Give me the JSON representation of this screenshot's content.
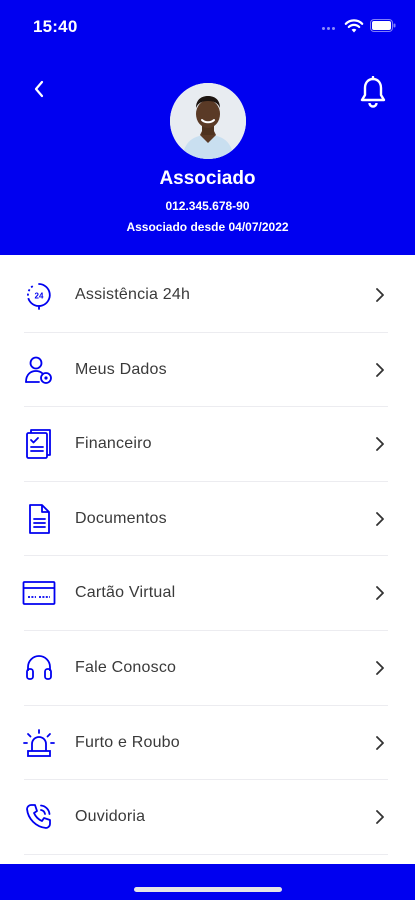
{
  "status_bar": {
    "time": "15:40"
  },
  "header": {
    "name": "Associado",
    "cpf": "012.345.678-90",
    "member_since": "Associado desde 04/07/2022",
    "background_color": "#0000f0"
  },
  "menu": {
    "items": [
      {
        "label": "Assistência 24h",
        "icon": "assistance-24h-icon"
      },
      {
        "label": "Meus Dados",
        "icon": "user-settings-icon"
      },
      {
        "label": "Financeiro",
        "icon": "financial-document-icon"
      },
      {
        "label": "Documentos",
        "icon": "document-icon"
      },
      {
        "label": "Cartão Virtual",
        "icon": "card-icon"
      },
      {
        "label": "Fale Conosco",
        "icon": "headset-icon"
      },
      {
        "label": "Furto e Roubo",
        "icon": "alarm-siren-icon"
      },
      {
        "label": "Ouvidoria",
        "icon": "phone-call-icon"
      }
    ],
    "icon_color": "#0000f0"
  }
}
